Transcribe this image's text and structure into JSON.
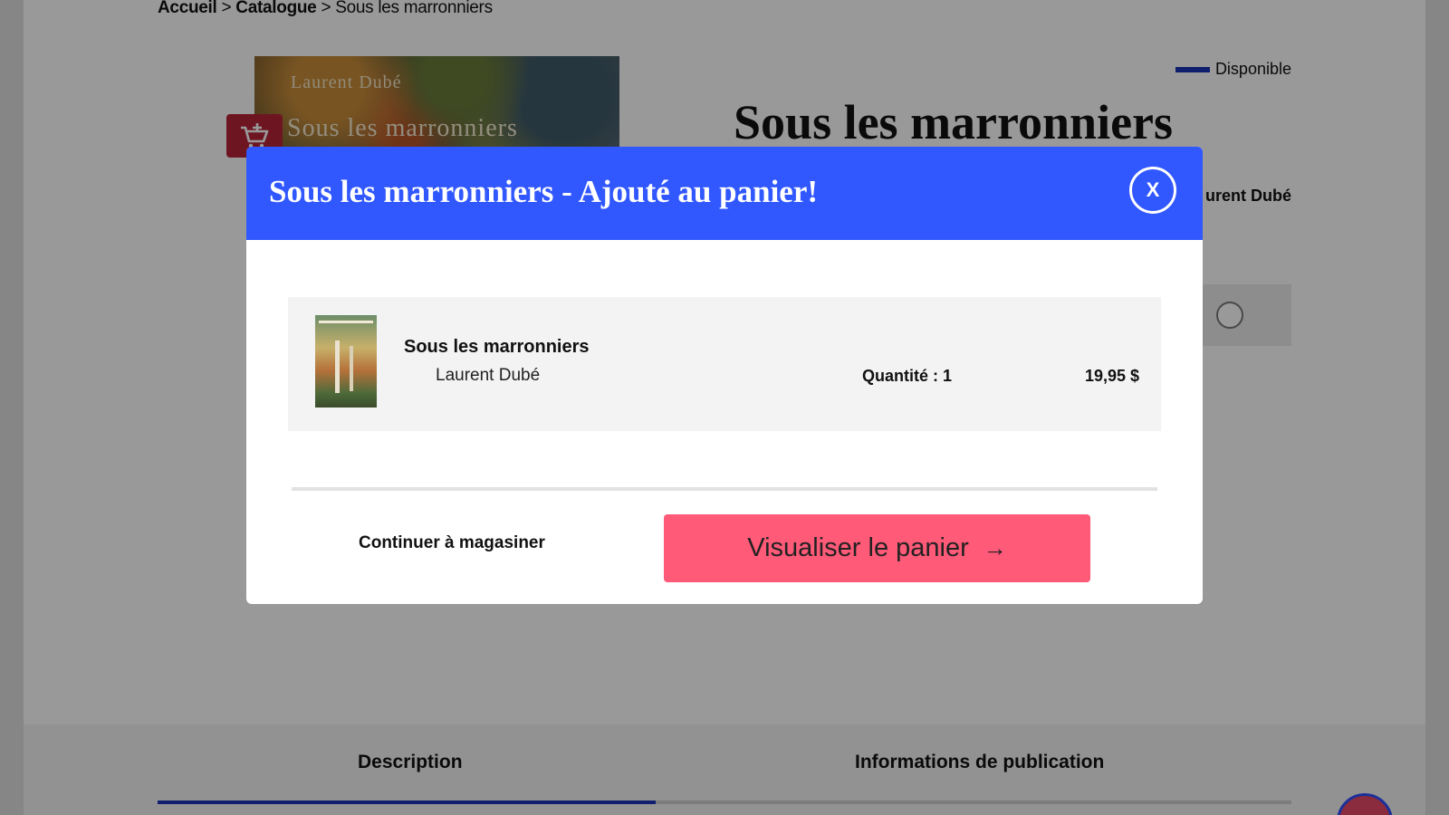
{
  "breadcrumb": {
    "home": "Accueil",
    "catalogue": "Catalogue",
    "current": "Sous les marronniers",
    "separator": ">"
  },
  "cover": {
    "author": "Laurent Dubé",
    "title": "Sous les marronniers"
  },
  "product": {
    "availability": "Disponible",
    "title": "Sous les marronniers",
    "author_partial": "urent Dubé"
  },
  "tabs": {
    "description": "Description",
    "publication": "Informations de publication"
  },
  "modal": {
    "title": "Sous les marronniers - Ajouté au panier!",
    "close_label": "X",
    "item": {
      "title": "Sous les marronniers",
      "author": "Laurent Dubé",
      "quantity": "Quantité : 1",
      "price": "19,95 $"
    },
    "continue_label": "Continuer à magasiner",
    "view_cart_label": "Visualiser le panier",
    "view_cart_arrow": "→"
  },
  "colors": {
    "modal_header": "#3157ff",
    "cta_button": "#ff5a78",
    "accent_blue": "#1a32b8",
    "cart_button": "#b8233a"
  },
  "icons": [
    "cart-add-icon",
    "close-icon",
    "arrow-right-icon",
    "arrow-up-icon"
  ]
}
